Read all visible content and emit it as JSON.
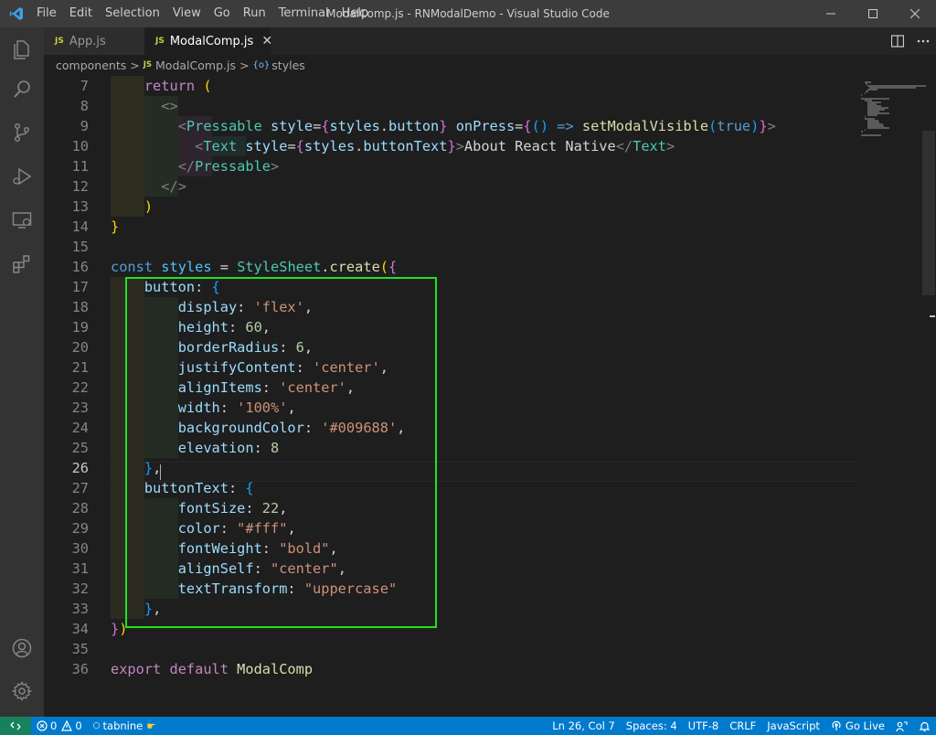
{
  "window": {
    "title": "ModalComp.js - RNModalDemo - Visual Studio Code"
  },
  "menu": {
    "items": [
      "File",
      "Edit",
      "Selection",
      "View",
      "Go",
      "Run",
      "Terminal",
      "Help"
    ]
  },
  "tabs": [
    {
      "label": "App.js",
      "icon": "JS",
      "active": false
    },
    {
      "label": "ModalComp.js",
      "icon": "JS",
      "active": true
    }
  ],
  "breadcrumb": {
    "folder": "components",
    "file": "ModalComp.js",
    "symbol": "styles",
    "file_icon": "JS"
  },
  "editor": {
    "line_numbers": [
      "7",
      "8",
      "9",
      "10",
      "11",
      "12",
      "13",
      "14",
      "15",
      "16",
      "17",
      "18",
      "19",
      "20",
      "21",
      "22",
      "23",
      "24",
      "25",
      "26",
      "27",
      "28",
      "29",
      "30",
      "31",
      "32",
      "33",
      "34",
      "35",
      "36"
    ],
    "active_line": "26",
    "lines": [
      "    return (",
      "      <>",
      "        <Pressable style={styles.button} onPress={() => setModalVisible(true)}>",
      "          <Text style={styles.buttonText}>About React Native</Text>",
      "        </Pressable>",
      "      </>",
      "    )",
      "}",
      "",
      "const styles = StyleSheet.create({",
      "    button: {",
      "        display: 'flex',",
      "        height: 60,",
      "        borderRadius: 6,",
      "        justifyContent: 'center',",
      "        alignItems: 'center',",
      "        width: '100%',",
      "        backgroundColor: '#009688',",
      "        elevation: 8",
      "    },",
      "    buttonText: {",
      "        fontSize: 22,",
      "        color: \"#fff\",",
      "        fontWeight: \"bold\",",
      "        alignSelf: \"center\",",
      "        textTransform: \"uppercase\"",
      "    },",
      "})",
      "",
      "export default ModalComp"
    ],
    "highlight_color": "#22e022"
  },
  "statusbar": {
    "remote_icon": "remote-icon",
    "errors": "0",
    "warnings": "0",
    "tabnine": "tabnine",
    "position": "Ln 26, Col 7",
    "spaces": "Spaces: 4",
    "encoding": "UTF-8",
    "eol": "CRLF",
    "language": "JavaScript",
    "golive": "Go Live",
    "color": "#007acc"
  }
}
